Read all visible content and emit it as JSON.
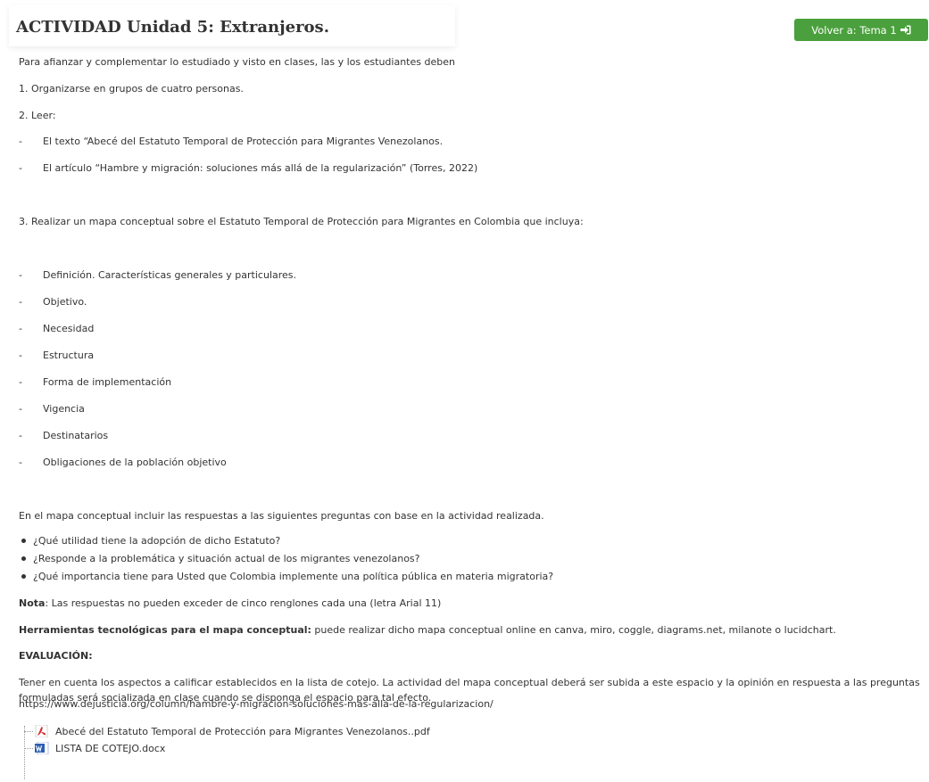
{
  "header": {
    "title": "ACTIVIDAD Unidad 5: Extranjeros.",
    "back_button_label": "Volver a: Tema 1"
  },
  "intro": "Para afianzar  y complementar lo estudiado y visto en clases, las y los estudiantes deben",
  "steps": {
    "step1": "1. Organizarse en grupos de cuatro personas.",
    "step2": "2. Leer:",
    "readings": [
      "El texto “Abecé del Estatuto Temporal de Protección para Migrantes Venezolanos.",
      "El artículo “Hambre y migración: soluciones más allá de la regularización” (Torres, 2022)"
    ],
    "step3": "3. Realizar un mapa conceptual sobre el Estatuto Temporal de Protección para Migrantes en Colombia que incluya:",
    "map_items": [
      "Definición. Características generales y particulares.",
      "Objetivo.",
      "Necesidad",
      "Estructura",
      "Forma de implementación",
      "Vigencia",
      "Destinatarios",
      "Obligaciones de la población objetivo"
    ]
  },
  "questions_intro": "En el mapa conceptual incluir las respuestas a las siguientes preguntas con base en la actividad realizada.",
  "questions": [
    "¿Qué utilidad tiene la adopción de dicho Estatuto?",
    "¿Responde a la problemática y situación actual de los migrantes venezolanos?",
    "¿Qué importancia tiene para Usted que Colombia implemente una política pública en materia migratoria?"
  ],
  "note": {
    "label": "Nota",
    "text": ": Las respuestas no pueden exceder de cinco renglones cada una (letra Arial 11)"
  },
  "tools": {
    "label": "Herramientas tecnológicas para el mapa conceptual:",
    "text": " puede realizar dicho mapa conceptual online en canva, miro, coggle, diagrams.net, milanote o lucidchart."
  },
  "evaluation": {
    "heading": "EVALUACIÓN:",
    "text": " Tener en cuenta los aspectos a calificar establecidos en la lista de cotejo. La actividad del mapa conceptual deberá ser subida a este espacio y la opinión en respuesta a las preguntas formuladas será socializada en clase cuando se disponga el espacio para tal efecto."
  },
  "link_url": "https://www.dejusticia.org/column/hambre-y-migracion-soluciones-mas-alla-de-la-regularizacion/",
  "files": [
    {
      "name": "Abecé del Estatuto Temporal de Protección para Migrantes Venezolanos..pdf",
      "icon": "pdf-icon"
    },
    {
      "name": "LISTA DE COTEJO.docx",
      "icon": "word-doc-icon"
    }
  ],
  "dash_symbol": "-",
  "colors": {
    "accent_green": "#4aa03c",
    "text": "#333333",
    "pdf_red": "#d9262a",
    "word_blue": "#2b5fb3"
  }
}
